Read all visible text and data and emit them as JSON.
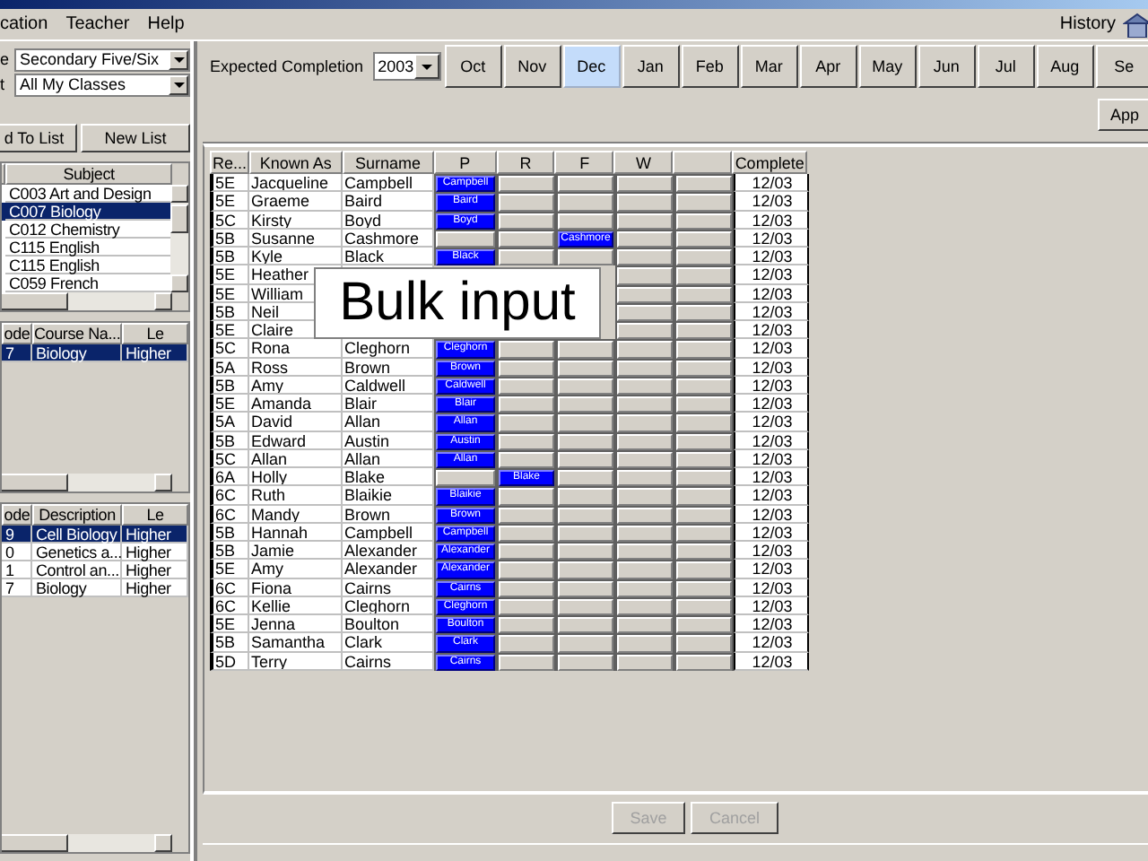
{
  "menu": [
    "cation",
    "Teacher",
    "Help"
  ],
  "history": {
    "label": "History"
  },
  "left": {
    "filters": [
      {
        "label": "e",
        "value": "Secondary Five/Six"
      },
      {
        "label": "t",
        "value": "All My Classes"
      }
    ],
    "buttons": [
      "d To List",
      "New List"
    ],
    "tables": [
      {
        "kind": "subjects",
        "columns": [
          "Subject"
        ],
        "rows": [
          {
            "cells": [
              "C003 Art and Design"
            ],
            "selected": false
          },
          {
            "cells": [
              "C007 Biology"
            ],
            "selected": true
          },
          {
            "cells": [
              "C012 Chemistry"
            ],
            "selected": false
          },
          {
            "cells": [
              "C115 English"
            ],
            "selected": false
          },
          {
            "cells": [
              "C115 English"
            ],
            "selected": false
          },
          {
            "cells": [
              "C059 French"
            ],
            "selected": false
          }
        ]
      },
      {
        "kind": "courses",
        "columns": [
          "ode",
          "Course Na...",
          "Le"
        ],
        "rows": [
          {
            "cells": [
              "7",
              "Biology",
              "Higher"
            ],
            "selected": true
          }
        ]
      },
      {
        "kind": "units",
        "columns": [
          "ode",
          "Description",
          "Le"
        ],
        "rows": [
          {
            "cells": [
              "9",
              "Cell Biology",
              "Higher"
            ],
            "selected": true
          },
          {
            "cells": [
              "0",
              "Genetics a...",
              "Higher"
            ],
            "selected": false
          },
          {
            "cells": [
              "1",
              "Control an...",
              "Higher"
            ],
            "selected": false
          },
          {
            "cells": [
              "7",
              "Biology",
              "Higher"
            ],
            "selected": false
          }
        ]
      }
    ]
  },
  "completion": {
    "label": "Expected Completion",
    "year": "2003",
    "months": [
      {
        "label": "Oct",
        "selected": false
      },
      {
        "label": "Nov",
        "selected": false
      },
      {
        "label": "Dec",
        "selected": true
      },
      {
        "label": "Jan",
        "selected": false
      },
      {
        "label": "Feb",
        "selected": false
      },
      {
        "label": "Mar",
        "selected": false
      },
      {
        "label": "Apr",
        "selected": false
      },
      {
        "label": "May",
        "selected": false
      },
      {
        "label": "Jun",
        "selected": false
      },
      {
        "label": "Jul",
        "selected": false
      },
      {
        "label": "Aug",
        "selected": false
      },
      {
        "label": "Se",
        "selected": false
      }
    ]
  },
  "apply_button": "App",
  "grid": {
    "columns": [
      "Re...",
      "Known As",
      "Surname",
      "P",
      "R",
      "F",
      "W",
      "",
      "Complete"
    ],
    "rows": [
      {
        "reg": "5E",
        "known_as": "Jacqueline",
        "surname": "Campbell",
        "marks": [
          {
            "on": true,
            "text": "Campbell"
          },
          {
            "on": false
          },
          {
            "on": false
          },
          {
            "on": false
          },
          {
            "on": false
          }
        ],
        "complete": "12/03"
      },
      {
        "reg": "5E",
        "known_as": "Graeme",
        "surname": "Baird",
        "marks": [
          {
            "on": true,
            "text": "Baird"
          },
          {
            "on": false
          },
          {
            "on": false
          },
          {
            "on": false
          },
          {
            "on": false
          }
        ],
        "complete": "12/03"
      },
      {
        "reg": "5C",
        "known_as": "Kirsty",
        "surname": "Boyd",
        "marks": [
          {
            "on": true,
            "text": "Boyd"
          },
          {
            "on": false
          },
          {
            "on": false
          },
          {
            "on": false
          },
          {
            "on": false
          }
        ],
        "complete": "12/03"
      },
      {
        "reg": "5B",
        "known_as": "Susanne",
        "surname": "Cashmore",
        "marks": [
          {
            "on": false
          },
          {
            "on": false
          },
          {
            "on": true,
            "text": "Cashmore"
          },
          {
            "on": false
          },
          {
            "on": false
          }
        ],
        "complete": "12/03"
      },
      {
        "reg": "5B",
        "known_as": "Kyle",
        "surname": "Black",
        "marks": [
          {
            "on": true,
            "text": "Black"
          },
          {
            "on": false
          },
          {
            "on": false
          },
          {
            "on": false
          },
          {
            "on": false
          }
        ],
        "complete": "12/03"
      },
      {
        "reg": "5E",
        "known_as": "Heather",
        "marks": [
          {
            "on": false
          },
          {
            "on": false
          }
        ],
        "complete": "12/03"
      },
      {
        "reg": "5E",
        "known_as": "William",
        "marks": [
          {
            "on": false
          },
          {
            "on": false
          }
        ],
        "complete": "12/03"
      },
      {
        "reg": "5B",
        "known_as": "Neil",
        "marks": [
          {
            "on": false
          },
          {
            "on": false
          }
        ],
        "complete": "12/03"
      },
      {
        "reg": "5E",
        "known_as": "Claire",
        "marks": [
          {
            "on": false
          },
          {
            "on": false
          }
        ],
        "complete": "12/03"
      },
      {
        "reg": "5C",
        "known_as": "Rona",
        "surname": "Cleghorn",
        "marks": [
          {
            "on": true,
            "text": "Cleghorn"
          },
          {
            "on": false
          },
          {
            "on": false
          },
          {
            "on": false
          },
          {
            "on": false
          }
        ],
        "complete": "12/03"
      },
      {
        "reg": "5A",
        "known_as": "Ross",
        "surname": "Brown",
        "marks": [
          {
            "on": true,
            "text": "Brown"
          },
          {
            "on": false
          },
          {
            "on": false
          },
          {
            "on": false
          },
          {
            "on": false
          }
        ],
        "complete": "12/03"
      },
      {
        "reg": "5B",
        "known_as": "Amy",
        "surname": "Caldwell",
        "marks": [
          {
            "on": true,
            "text": "Caldwell"
          },
          {
            "on": false
          },
          {
            "on": false
          },
          {
            "on": false
          },
          {
            "on": false
          }
        ],
        "complete": "12/03"
      },
      {
        "reg": "5E",
        "known_as": "Amanda",
        "surname": "Blair",
        "marks": [
          {
            "on": true,
            "text": "Blair"
          },
          {
            "on": false
          },
          {
            "on": false
          },
          {
            "on": false
          },
          {
            "on": false
          }
        ],
        "complete": "12/03"
      },
      {
        "reg": "5A",
        "known_as": "David",
        "surname": "Allan",
        "marks": [
          {
            "on": true,
            "text": "Allan"
          },
          {
            "on": false
          },
          {
            "on": false
          },
          {
            "on": false
          },
          {
            "on": false
          }
        ],
        "complete": "12/03"
      },
      {
        "reg": "5B",
        "known_as": "Edward",
        "surname": "Austin",
        "marks": [
          {
            "on": true,
            "text": "Austin"
          },
          {
            "on": false
          },
          {
            "on": false
          },
          {
            "on": false
          },
          {
            "on": false
          }
        ],
        "complete": "12/03"
      },
      {
        "reg": "5C",
        "known_as": "Allan",
        "surname": "Allan",
        "marks": [
          {
            "on": true,
            "text": "Allan"
          },
          {
            "on": false
          },
          {
            "on": false
          },
          {
            "on": false
          },
          {
            "on": false
          }
        ],
        "complete": "12/03"
      },
      {
        "reg": "6A",
        "known_as": "Holly",
        "surname": "Blake",
        "marks": [
          {
            "on": false
          },
          {
            "on": true,
            "text": "Blake"
          },
          {
            "on": false
          },
          {
            "on": false
          },
          {
            "on": false
          }
        ],
        "complete": "12/03"
      },
      {
        "reg": "6C",
        "known_as": "Ruth",
        "surname": "Blaikie",
        "marks": [
          {
            "on": true,
            "text": "Blaikie"
          },
          {
            "on": false
          },
          {
            "on": false
          },
          {
            "on": false
          },
          {
            "on": false
          }
        ],
        "complete": "12/03"
      },
      {
        "reg": "6C",
        "known_as": "Mandy",
        "surname": "Brown",
        "marks": [
          {
            "on": true,
            "text": "Brown"
          },
          {
            "on": false
          },
          {
            "on": false
          },
          {
            "on": false
          },
          {
            "on": false
          }
        ],
        "complete": "12/03"
      },
      {
        "reg": "5B",
        "known_as": "Hannah",
        "surname": "Campbell",
        "marks": [
          {
            "on": true,
            "text": "Campbell"
          },
          {
            "on": false
          },
          {
            "on": false
          },
          {
            "on": false
          },
          {
            "on": false
          }
        ],
        "complete": "12/03"
      },
      {
        "reg": "5B",
        "known_as": "Jamie",
        "surname": "Alexander",
        "marks": [
          {
            "on": true,
            "text": "Alexander"
          },
          {
            "on": false
          },
          {
            "on": false
          },
          {
            "on": false
          },
          {
            "on": false
          }
        ],
        "complete": "12/03"
      },
      {
        "reg": "5E",
        "known_as": "Amy",
        "surname": "Alexander",
        "marks": [
          {
            "on": true,
            "text": "Alexander"
          },
          {
            "on": false
          },
          {
            "on": false
          },
          {
            "on": false
          },
          {
            "on": false
          }
        ],
        "complete": "12/03"
      },
      {
        "reg": "6C",
        "known_as": "Fiona",
        "surname": "Cairns",
        "marks": [
          {
            "on": true,
            "text": "Cairns"
          },
          {
            "on": false
          },
          {
            "on": false
          },
          {
            "on": false
          },
          {
            "on": false
          }
        ],
        "complete": "12/03"
      },
      {
        "reg": "6C",
        "known_as": "Kellie",
        "surname": "Cleghorn",
        "marks": [
          {
            "on": true,
            "text": "Cleghorn"
          },
          {
            "on": false
          },
          {
            "on": false
          },
          {
            "on": false
          },
          {
            "on": false
          }
        ],
        "complete": "12/03"
      },
      {
        "reg": "5E",
        "known_as": "Jenna",
        "surname": "Boulton",
        "marks": [
          {
            "on": true,
            "text": "Boulton"
          },
          {
            "on": false
          },
          {
            "on": false
          },
          {
            "on": false
          },
          {
            "on": false
          }
        ],
        "complete": "12/03"
      },
      {
        "reg": "5B",
        "known_as": "Samantha",
        "surname": "Clark",
        "marks": [
          {
            "on": true,
            "text": "Clark"
          },
          {
            "on": false
          },
          {
            "on": false
          },
          {
            "on": false
          },
          {
            "on": false
          }
        ],
        "complete": "12/03"
      },
      {
        "reg": "5D",
        "known_as": "Terry",
        "surname": "Cairns",
        "marks": [
          {
            "on": true,
            "text": "Cairns"
          },
          {
            "on": false
          },
          {
            "on": false
          },
          {
            "on": false
          },
          {
            "on": false
          }
        ],
        "complete": "12/03"
      }
    ]
  },
  "overlay": {
    "text": "Bulk input"
  },
  "buttons": [
    {
      "label": "Save",
      "disabled": true
    },
    {
      "label": "Cancel",
      "disabled": true
    }
  ]
}
